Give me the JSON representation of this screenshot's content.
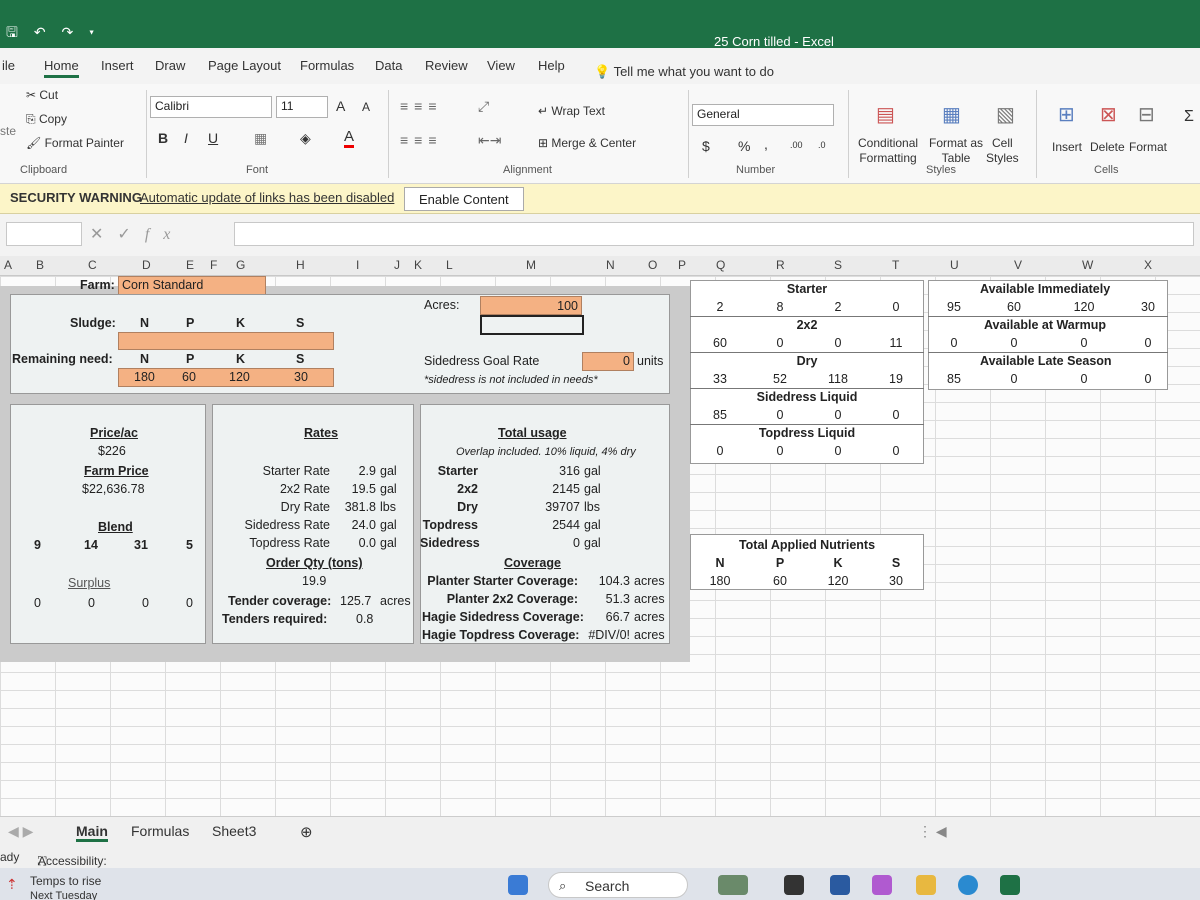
{
  "window": {
    "title": "25 Corn tilled  -  Excel"
  },
  "menu": {
    "file": "ile",
    "tabs": [
      "Home",
      "Insert",
      "Draw",
      "Page Layout",
      "Formulas",
      "Data",
      "Review",
      "View",
      "Help"
    ],
    "tell_me": "Tell me what you want to do"
  },
  "ribbon": {
    "clipboard": {
      "cut": "Cut",
      "copy": "Copy",
      "format_painter": "Format Painter",
      "label": "Clipboard",
      "paste_partial": "ste"
    },
    "font": {
      "name": "Calibri",
      "size": "11",
      "grow": "A",
      "shrink": "A",
      "bold": "B",
      "italic": "I",
      "underline": "U",
      "color": "A",
      "label": "Font"
    },
    "alignment": {
      "wrap": "Wrap Text",
      "merge": "Merge & Center",
      "label": "Alignment"
    },
    "number": {
      "format": "General",
      "currency": "$",
      "percent": "%",
      "comma": ",",
      "inc": ".00",
      "dec": ".0",
      "label": "Number"
    },
    "styles": {
      "conditional_1": "Conditional",
      "conditional_2": "Formatting",
      "table_1": "Format as",
      "table_2": "Table",
      "cell_1": "Cell",
      "cell_2": "Styles",
      "label": "Styles"
    },
    "cells": {
      "insert": "Insert",
      "delete": "Delete",
      "format": "Format",
      "label": "Cells"
    }
  },
  "security": {
    "label": "SECURITY WARNING",
    "message": "Automatic update of links has been disabled",
    "button": "Enable Content"
  },
  "formula_bar": {
    "fx": "fx"
  },
  "columns": [
    "A",
    "B",
    "C",
    "D",
    "E",
    "F",
    "G",
    "H",
    "I",
    "J",
    "K",
    "L",
    "M",
    "N",
    "O",
    "P",
    "Q",
    "R",
    "S",
    "T",
    "U",
    "V",
    "W",
    "X"
  ],
  "sheet": {
    "farm_label": "Farm:",
    "farm_value": "Corn Standard",
    "sludge_label": "Sludge:",
    "remaining_label": "Remaining need:",
    "nutrients": [
      "N",
      "P",
      "K",
      "S"
    ],
    "remaining": [
      "180",
      "60",
      "120",
      "30"
    ],
    "acres_label": "Acres:",
    "acres_value": "100",
    "sidedress_goal_label": "Sidedress Goal Rate",
    "sidedress_goal_value": "0",
    "sidedress_goal_unit": "units",
    "sidedress_note": "*sidedress is not included in needs*",
    "price_ac_label": "Price/ac",
    "price_ac_value": "$226",
    "farm_price_label": "Farm Price",
    "farm_price_value": "$22,636.78",
    "blend_label": "Blend",
    "blend": [
      "9",
      "14",
      "31",
      "5"
    ],
    "surplus_label": "Surplus",
    "surplus": [
      "0",
      "0",
      "0",
      "0"
    ],
    "rates_title": "Rates",
    "rates": [
      {
        "name": "Starter Rate",
        "value": "2.9",
        "unit": "gal"
      },
      {
        "name": "2x2 Rate",
        "value": "19.5",
        "unit": "gal"
      },
      {
        "name": "Dry Rate",
        "value": "381.8",
        "unit": "lbs"
      },
      {
        "name": "Sidedress Rate",
        "value": "24.0",
        "unit": "gal"
      },
      {
        "name": "Topdress Rate",
        "value": "0.0",
        "unit": "gal"
      }
    ],
    "order_qty_label": "Order Qty (tons)",
    "order_qty_value": "19.9",
    "tender_coverage_label": "Tender coverage:",
    "tender_coverage_value": "125.7",
    "tender_coverage_unit": "acres",
    "tenders_required_label": "Tenders required:",
    "tenders_required_value": "0.8",
    "usage_title": "Total usage",
    "usage_note": "Overlap included. 10% liquid, 4% dry",
    "usage": [
      {
        "name": "Starter",
        "value": "316",
        "unit": "gal"
      },
      {
        "name": "2x2",
        "value": "2145",
        "unit": "gal"
      },
      {
        "name": "Dry",
        "value": "39707",
        "unit": "lbs"
      },
      {
        "name": "Topdress",
        "value": "2544",
        "unit": "gal"
      },
      {
        "name": "Sidedress",
        "value": "0",
        "unit": "gal"
      }
    ],
    "coverage_title": "Coverage",
    "coverage": [
      {
        "name": "Planter Starter Coverage:",
        "value": "104.3",
        "unit": "acres"
      },
      {
        "name": "Planter 2x2 Coverage:",
        "value": "51.3",
        "unit": "acres"
      },
      {
        "name": "Hagie Sidedress Coverage:",
        "value": "66.7",
        "unit": "acres"
      },
      {
        "name": "Hagie Topdress Coverage:",
        "value": "#DIV/0!",
        "unit": "acres"
      }
    ],
    "product_table": {
      "starter_label": "Starter",
      "starter": [
        "2",
        "8",
        "2",
        "0"
      ],
      "x2x2_label": "2x2",
      "x2x2": [
        "60",
        "0",
        "0",
        "11"
      ],
      "dry_label": "Dry",
      "dry": [
        "33",
        "52",
        "118",
        "19"
      ],
      "sidedress_label": "Sidedress Liquid",
      "sidedress": [
        "85",
        "0",
        "0",
        "0"
      ],
      "topdress_label": "Topdress Liquid",
      "topdress": [
        "0",
        "0",
        "0",
        "0"
      ]
    },
    "availability": {
      "immediately_label": "Available Immediately",
      "immediately": [
        "95",
        "60",
        "120",
        "30"
      ],
      "warmup_label": "Available at Warmup",
      "warmup": [
        "0",
        "0",
        "0",
        "0"
      ],
      "late_label": "Available Late Season",
      "late": [
        "85",
        "0",
        "0",
        "0"
      ]
    },
    "total_applied_label": "Total Applied Nutrients",
    "total_applied": [
      "180",
      "60",
      "120",
      "30"
    ]
  },
  "sheet_tabs": [
    "Main",
    "Formulas",
    "Sheet3"
  ],
  "status": {
    "ready": "ady",
    "accessibility": "Accessibility: Investigate"
  },
  "taskbar": {
    "weather_1": "Temps to rise",
    "weather_2": "Next Tuesday",
    "search": "Search"
  }
}
